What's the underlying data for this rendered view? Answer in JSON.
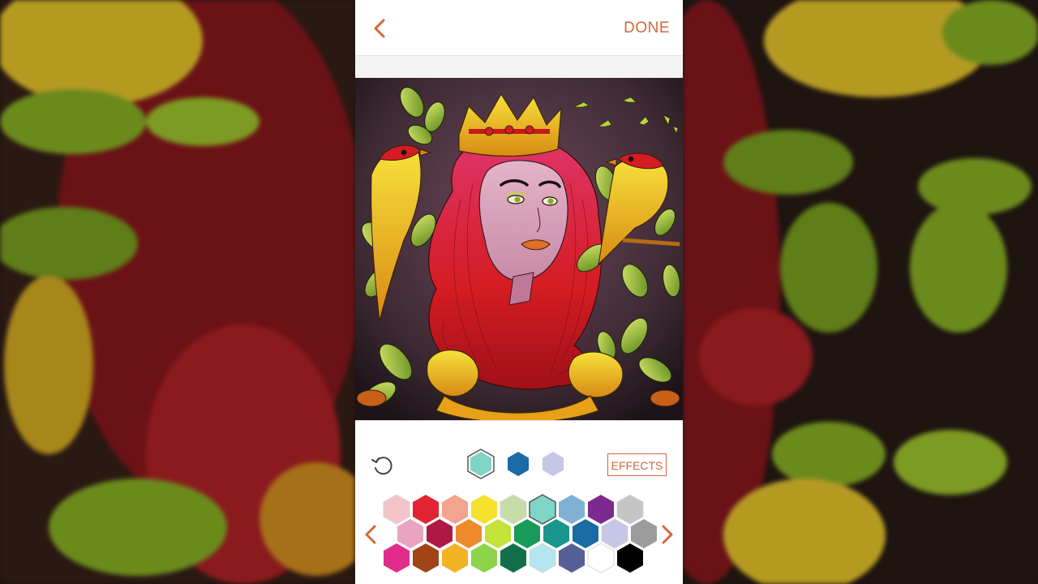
{
  "topbar": {
    "done_label": "DONE"
  },
  "toolbar": {
    "effects_label": "EFFECTS"
  },
  "recent_colors": [
    "#7fd4c8",
    "#1a6aa6",
    "#c6c6e6"
  ],
  "palette_rows": [
    [
      "#f2c4c8",
      "#e22432",
      "#f2a48c",
      "#f5e02e",
      "#c6dca8",
      "#7fd4c8",
      "#7fb1d4",
      "#7c2a8f",
      "#c4c4c4"
    ],
    [
      "#e8a4c0",
      "#b01844",
      "#ef8a2c",
      "#c4e23a",
      "#1a9a58",
      "#18968c",
      "#1a6aa6",
      "#c6c6e6",
      "#9c9c9c"
    ],
    [
      "#e22c8c",
      "#a04416",
      "#f2b224",
      "#8cd44a",
      "#127048",
      "#b4e4ee",
      "#556096",
      "#ffffff",
      "#000000"
    ]
  ],
  "selected_color": "#7fd4c8",
  "colors": {
    "accent": "#d4673a"
  }
}
